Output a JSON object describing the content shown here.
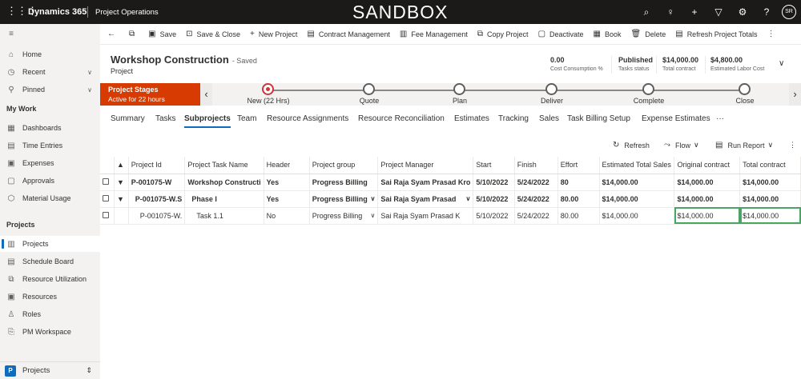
{
  "topbar": {
    "app_name": "Dynamics 365",
    "area_name": "Project Operations",
    "env_banner": "SANDBOX",
    "avatar_initials": "SR"
  },
  "sidebar": {
    "home": "Home",
    "recent": "Recent",
    "pinned": "Pinned",
    "my_work_header": "My Work",
    "my_work": [
      "Dashboards",
      "Time Entries",
      "Expenses",
      "Approvals",
      "Material Usage"
    ],
    "projects_header": "Projects",
    "projects": [
      "Projects",
      "Schedule Board",
      "Resource Utilization",
      "Resources",
      "Roles",
      "PM Workspace"
    ],
    "area_switcher_tile": "P",
    "area_switcher_label": "Projects"
  },
  "commandbar": {
    "save": "Save",
    "save_close": "Save & Close",
    "new_project": "New Project",
    "contract_mgmt": "Contract Management",
    "fee_mgmt": "Fee Management",
    "copy_project": "Copy Project",
    "deactivate": "Deactivate",
    "book": "Book",
    "delete": "Delete",
    "refresh_totals": "Refresh Project Totals"
  },
  "record": {
    "title": "Workshop Construction",
    "saved_status": "- Saved",
    "entity": "Project",
    "fields": [
      {
        "value": "0.00",
        "label": "Cost Consumption %"
      },
      {
        "value": "Published",
        "label": "Tasks status"
      },
      {
        "value": "$14,000.00",
        "label": "Total contract"
      },
      {
        "value": "$4,800.00",
        "label": "Estimated Labor Cost"
      }
    ]
  },
  "bpf": {
    "stage_title": "Project Stages",
    "stage_sub": "Active for 22 hours",
    "stages": [
      "New  (22 Hrs)",
      "Quote",
      "Plan",
      "Deliver",
      "Complete",
      "Close"
    ],
    "active_stage_index": 0
  },
  "tabs": [
    "Summary",
    "Tasks",
    "Subprojects",
    "Team",
    "Resource Assignments",
    "Resource Reconciliation",
    "Estimates",
    "Tracking",
    "Sales",
    "Task Billing Setup",
    "Expense Estimates",
    "···"
  ],
  "selected_tab": "Subprojects",
  "grid_toolbar": {
    "refresh": "Refresh",
    "flow": "Flow",
    "run_report": "Run Report"
  },
  "grid": {
    "columns": [
      "Project Id",
      "Project Task Name",
      "Header",
      "Project group",
      "Project Manager",
      "Start",
      "Finish",
      "Effort",
      "Estimated Total Sales",
      "Original contract",
      "Total contract"
    ],
    "sort_indicator": "▲",
    "rows": [
      {
        "level": 0,
        "expander": "▼",
        "bold": true,
        "cells": [
          "P-001075-W",
          "Workshop Constructi",
          "Yes",
          "Progress Billing",
          "Sai Raja Syam Prasad Kro",
          "5/10/2022",
          "5/24/2022",
          "80",
          "$14,000.00",
          "$14,000.00",
          "$14,000.00"
        ]
      },
      {
        "level": 1,
        "expander": "▼",
        "bold": true,
        "cells": [
          "P-001075-W.S",
          "Phase I",
          "Yes",
          "Progress Billing",
          "Sai Raja Syam Prasad",
          "5/10/2022",
          "5/24/2022",
          "80.00",
          "$14,000.00",
          "$14,000.00",
          "$14,000.00"
        ]
      },
      {
        "level": 2,
        "expander": "",
        "bold": false,
        "cells": [
          "P-001075-W.",
          "Task 1.1",
          "No",
          "Progress Billing",
          "Sai Raja Syam Prasad K",
          "5/10/2022",
          "5/24/2022",
          "80.00",
          "$14,000.00",
          "$14,000.00",
          "$14,000.00"
        ]
      }
    ]
  }
}
